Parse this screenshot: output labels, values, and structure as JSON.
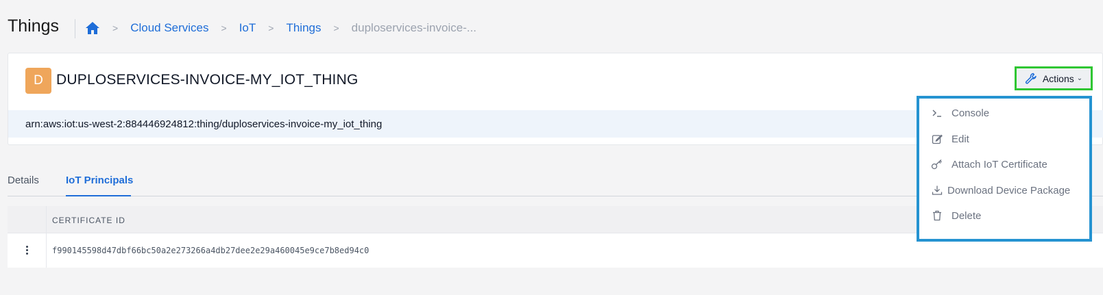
{
  "header": {
    "title": "Things",
    "breadcrumbs": [
      "Cloud Services",
      "IoT",
      "Things"
    ],
    "breadcrumb_current": "duploservices-invoice-..."
  },
  "thing": {
    "avatar_letter": "D",
    "name": "DUPLOSERVICES-INVOICE-MY_IOT_THING",
    "arn": "arn:aws:iot:us-west-2:884446924812:thing/duploservices-invoice-my_iot_thing",
    "avatar_color": "#efa65b"
  },
  "actions": {
    "label": "Actions",
    "menu": [
      {
        "label": "Console",
        "icon": "terminal-icon"
      },
      {
        "label": "Edit",
        "icon": "edit-icon"
      },
      {
        "label": "Attach IoT Certificate",
        "icon": "key-icon"
      },
      {
        "label": "Download Device Package",
        "icon": "download-icon"
      },
      {
        "label": "Delete",
        "icon": "trash-icon"
      }
    ]
  },
  "tabs": [
    {
      "label": "Details",
      "active": false
    },
    {
      "label": "IoT Principals",
      "active": true
    }
  ],
  "table": {
    "columns": [
      "CERTIFICATE ID"
    ],
    "rows": [
      {
        "certificate_id": "f990145598d47dbf66bc50a2e273266a4db27dee2e29a460045e9ce7b8ed94c0"
      }
    ]
  },
  "colors": {
    "accent": "#1e6dd8",
    "actions_highlight": "#2fc632",
    "dropdown_highlight": "#2593d1"
  }
}
